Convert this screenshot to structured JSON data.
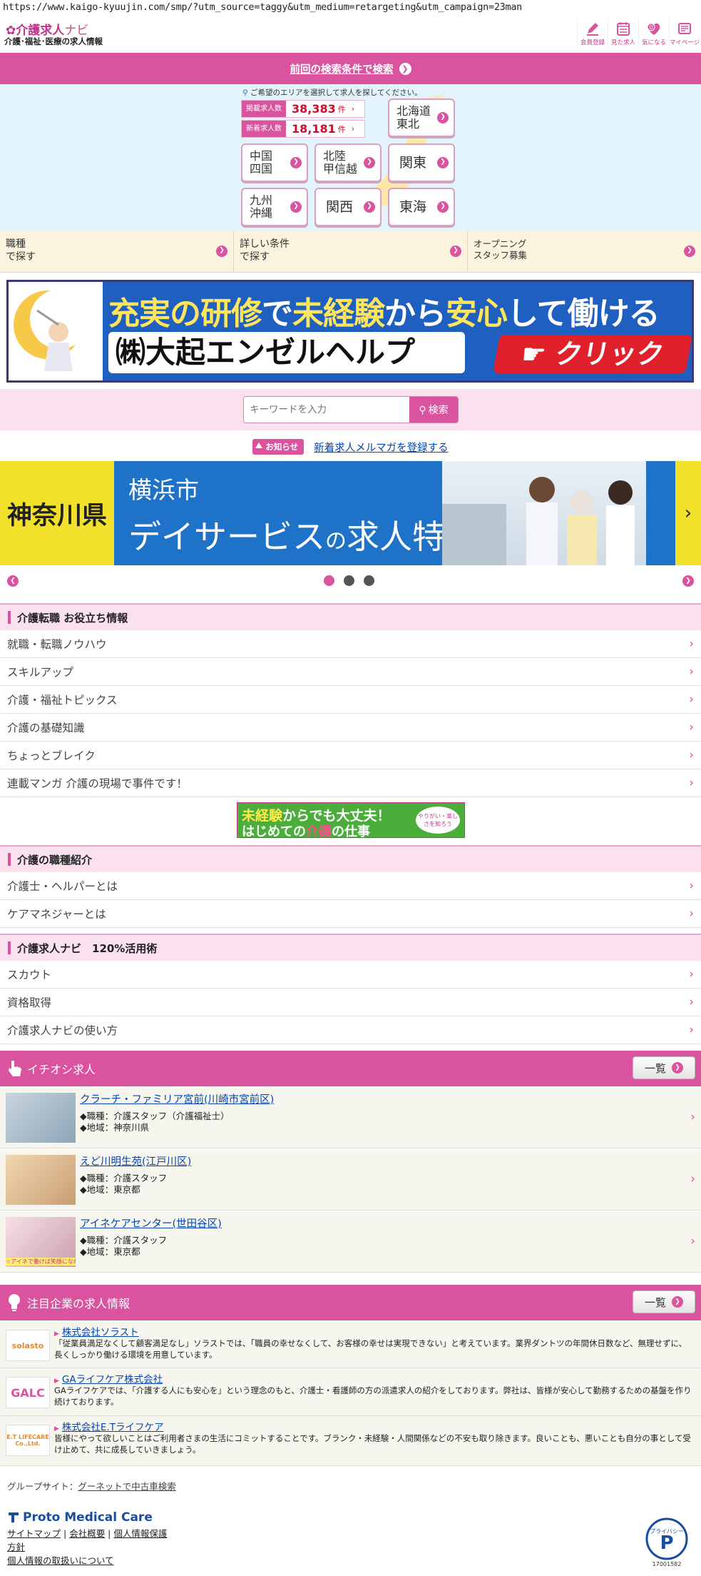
{
  "browser": {
    "url": "https://www.kaigo-kyuujin.com/smp/?utm_source=taggy&utm_medium=retargeting&utm_campaign=23man"
  },
  "header": {
    "logo_title": "介護求人",
    "logo_navi": "ナビ",
    "logo_sub": "介護･福祉･医療の求人情報",
    "icons": [
      {
        "label": "会員登録",
        "icon": "pencil-icon"
      },
      {
        "label": "見た求人",
        "icon": "calendar-icon"
      },
      {
        "label": "気になる",
        "icon": "heart-icon"
      },
      {
        "label": "マイページ",
        "icon": "mypage-icon"
      }
    ],
    "heart_count": "0"
  },
  "prev_search": {
    "label": "前回の検索条件で検索"
  },
  "area": {
    "hint": "ご希望のエリアを選択して求人を探してください。",
    "posted_label": "掲載求人数",
    "posted_count": "38,383",
    "unit": "件",
    "new_label": "新着求人数",
    "new_count": "18,181",
    "regions": [
      {
        "line1": "北海道",
        "line2": "東北"
      },
      {
        "line1": "中国",
        "line2": "四国"
      },
      {
        "line1": "北陸",
        "line2": "甲信越"
      },
      {
        "line1": "関東",
        "line2": ""
      },
      {
        "line1": "九州",
        "line2": "沖縄"
      },
      {
        "line1": "関西",
        "line2": ""
      },
      {
        "line1": "東海",
        "line2": ""
      }
    ]
  },
  "search_tabs": [
    {
      "line1": "職種",
      "line2": "で探す"
    },
    {
      "line1": "詳しい条件",
      "line2": "で探す"
    },
    {
      "line1": "オープニング",
      "line2": "スタッフ募集"
    }
  ],
  "banner1": {
    "top_a": "充実の研修",
    "top_b": "で",
    "top_c": "未経験",
    "top_d": "から",
    "top_e": "安心",
    "top_f": "して働ける",
    "company": "㈱大起エンゼルヘルプ",
    "click": "クリック"
  },
  "keyword": {
    "placeholder": "キーワードを入力",
    "button": "検索"
  },
  "notice": {
    "badge": "お知らせ",
    "link": "新着求人メルマガを登録する"
  },
  "slider": {
    "left": "神奈川県",
    "title1": "横浜市",
    "title2a": "デイサービス",
    "title2b": "の",
    "title2c": "求人特集",
    "right": "›",
    "active_index": 0,
    "total": 3
  },
  "sections": {
    "tips": {
      "title": "介護転職 お役立ち情報",
      "items": [
        "就職・転職ノウハウ",
        "スキルアップ",
        "介護・福祉トピックス",
        "介護の基礎知識",
        "ちょっとブレイク",
        "連載マンガ 介護の現場で事件です！"
      ]
    },
    "mid_banner": {
      "t1a": "未経験",
      "t1b": "からでも大丈夫！",
      "t2a": "はじめての",
      "t2b": "介護",
      "t2c": "の仕事",
      "side": "やりがい・楽しさを知ろう"
    },
    "jobtypes": {
      "title": "介護の職種紹介",
      "items": [
        "介護士・ヘルパーとは",
        "ケアマネジャーとは"
      ]
    },
    "usage": {
      "title": "介護求人ナビ　120%活用術",
      "items": [
        "スカウト",
        "資格取得",
        "介護求人ナビの使い方"
      ]
    }
  },
  "featured": {
    "title": "イチオシ求人",
    "list_button": "一覧",
    "jobs": [
      {
        "title": "クラーチ・ファミリア宮前(川崎市宮前区)",
        "job": "◆職種：介護スタッフ（介護福祉士）",
        "area": "◆地域：神奈川県"
      },
      {
        "title": "えど川明生苑(江戸川区)",
        "job": "◆職種：介護スタッフ",
        "area": "◆地域：東京都"
      },
      {
        "title": "アイネケアセンター(世田谷区)",
        "job": "◆職種：介護スタッフ",
        "area": "◆地域：東京都",
        "thumb_caption": "☆アイネで働けば笑顔になれる☆"
      }
    ]
  },
  "companies": {
    "title": "注目企業の求人情報",
    "list_button": "一覧",
    "items": [
      {
        "name": "株式会社ソラスト",
        "logo": "solasto",
        "desc": "「従業員満足なくして顧客満足なし」ソラストでは、「職員の幸せなくして、お客様の幸せは実現できない」と考えています。業界ダントツの年間休日数など、無理せずに、長くしっかり働ける環境を用意しています。"
      },
      {
        "name": "GAライフケア株式会社",
        "logo": "GALC",
        "desc": "GAライフケアでは、「介護する人にも安心を」という理念のもと、介護士・看護師の方の派遣求人の紹介をしております。弊社は、皆様が安心して勤務するための基盤を作り続けております。"
      },
      {
        "name": "株式会社E.Tライフケア",
        "logo": "E.T LIFECARE Co.,Ltd.",
        "desc": "皆様にやって欲しいことはご利用者さまの生活にコミットすることです。ブランク・未経験・人間関係などの不安も取り除きます。良いことも、悪いことも自分の事として受け止めて、共に成長していきましょう。"
      }
    ]
  },
  "footer": {
    "group_label": "グループサイト：",
    "group_link": "グーネットで中古車検索",
    "brand": "Proto Medical Care",
    "links": [
      "サイトマップ",
      "会社概要",
      "個人情報保護",
      "方針",
      "個人情報の取扱いについて"
    ],
    "privacy_mark_id": "17001582",
    "privacy_mark_text": "プライバシー"
  },
  "colors": {
    "brand_pink": "#d9539f",
    "link_blue": "#0645ad",
    "count_red": "#c8102e"
  }
}
